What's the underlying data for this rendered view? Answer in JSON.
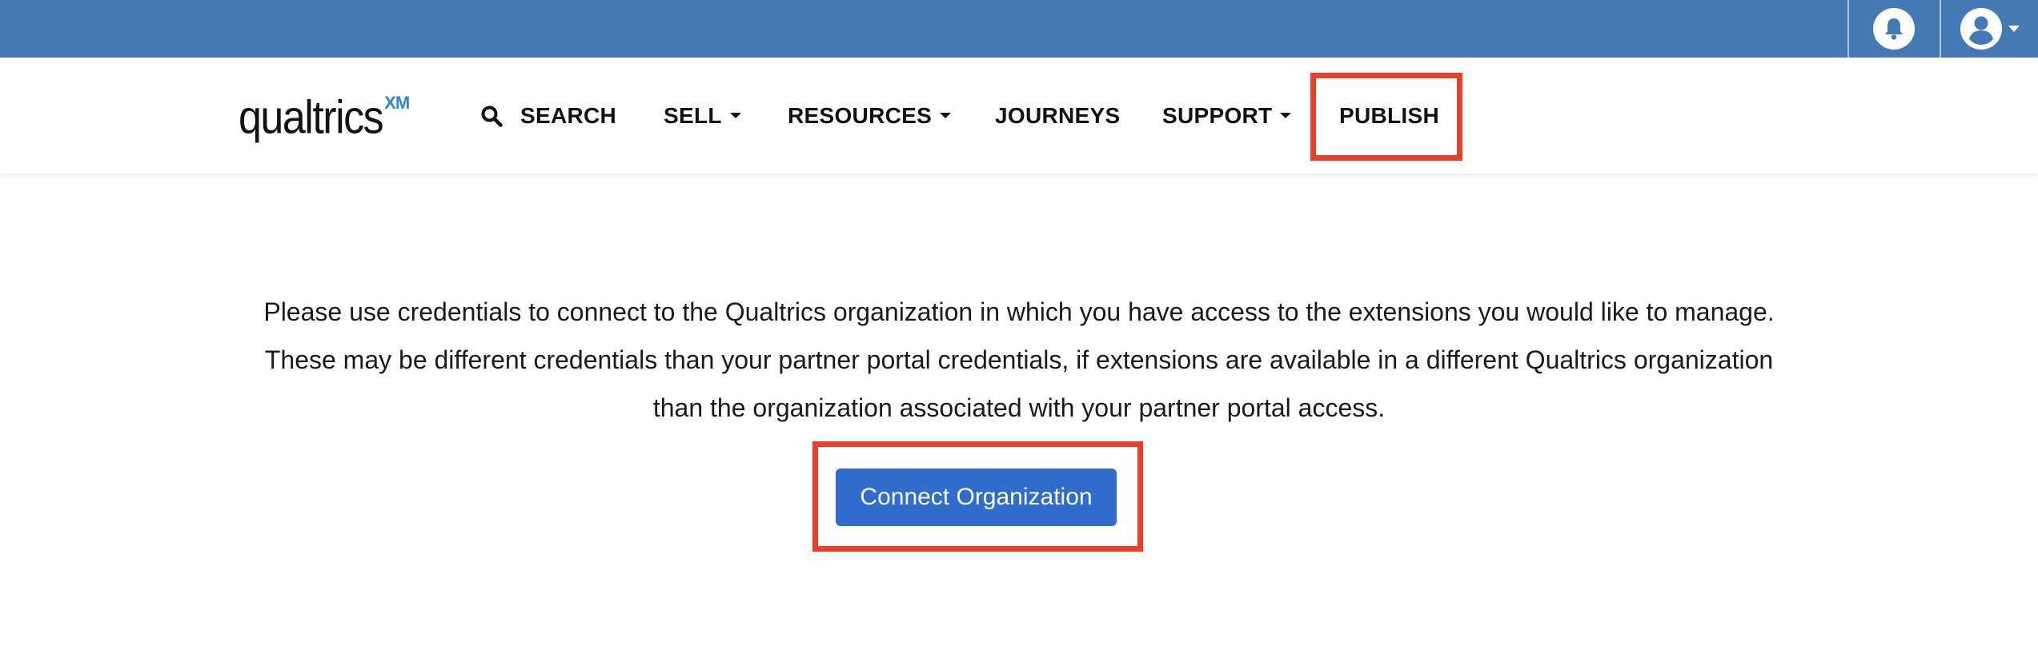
{
  "colors": {
    "topbar": "#4579b4",
    "accent_button": "#2f6ccb",
    "highlight_box": "#e8402a",
    "logo_xm": "#2f86d6"
  },
  "header": {
    "notification_icon": "bell-icon",
    "account_icon": "user-circle-icon"
  },
  "logo": {
    "word": "qualtrics",
    "suffix": "XM"
  },
  "nav": {
    "search_icon": "search-icon",
    "search_label": "SEARCH",
    "sell_label": "SELL",
    "resources_label": "RESOURCES",
    "journeys_label": "JOURNEYS",
    "support_label": "SUPPORT",
    "publish_label": "PUBLISH"
  },
  "main": {
    "lines": [
      "Please use credentials to connect to the Qualtrics organization in which you have access to the extensions you would like to manage.",
      "These may be different credentials than your partner portal credentials, if extensions are available in a different Qualtrics organization",
      "than the organization associated with your partner portal access."
    ],
    "connect_button_label": "Connect Organization"
  }
}
